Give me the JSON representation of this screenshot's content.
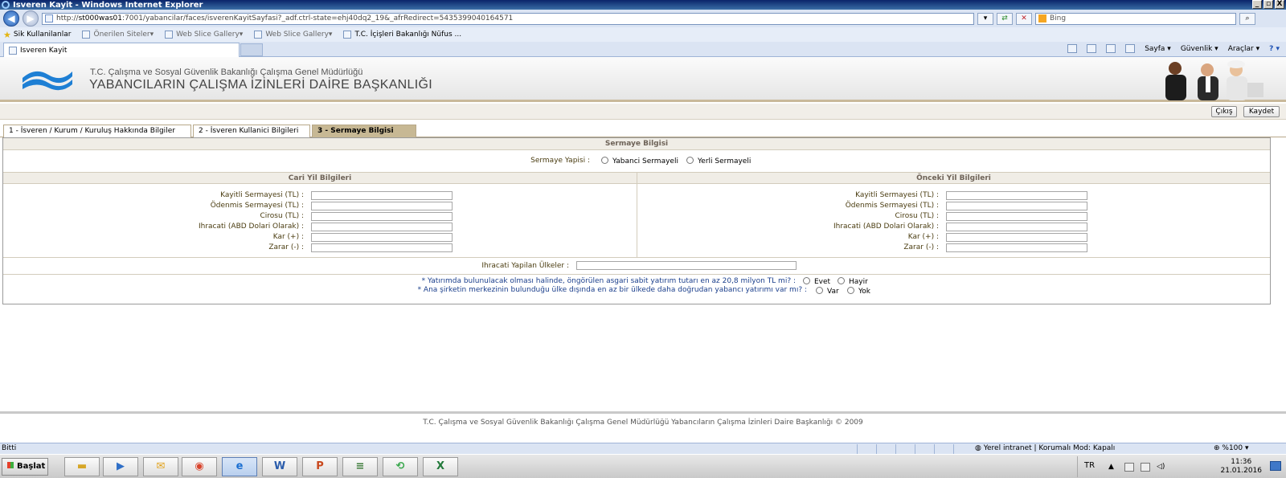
{
  "window": {
    "title": "Isveren Kayit - Windows Internet Explorer",
    "buttons": [
      "_",
      "▫",
      "X"
    ]
  },
  "address": {
    "prefix": "http://",
    "host": "st000was01",
    "path": ":7001/yabancilar/faces/isverenKayitSayfasi?_adf.ctrl-state=ehj40dq2_19&_afrRedirect=5435399040164571",
    "search_placeholder": "Bing"
  },
  "favorites": {
    "label": "Sik Kullanilanlar",
    "items": [
      "Önerilen Siteler",
      "Web Slice Gallery",
      "Web Slice Gallery",
      "T.C. İçişleri Bakanlığı Nüfus ..."
    ]
  },
  "tab": {
    "title": "Isveren Kayit"
  },
  "commandbar": {
    "sayfa": "Sayfa",
    "guvenlik": "Güvenlik",
    "araclar": "Araçlar"
  },
  "banner": {
    "ministry": "T.C. Çalışma ve Sosyal Güvenlik Bakanlığı Çalışma Genel Müdürlüğü",
    "department": "YABANCILARIN ÇALIŞMA İZİNLERİ DAİRE BAŞKANLIĞI"
  },
  "actions": {
    "exit": "Çıkış",
    "save": "Kaydet"
  },
  "form_tabs": [
    "1 - İsveren / Kurum / Kuruluş Hakkında Bilgiler",
    "2 - İsveren Kullanici Bilgileri",
    "3 - Sermaye Bilgisi"
  ],
  "form": {
    "section_title": "Sermaye Bilgisi",
    "capital_structure_label": "Sermaye Yapisi :",
    "foreign_capital": "Yabanci Sermayeli",
    "local_capital": "Yerli Sermayeli",
    "current_year_title": "Cari Yil Bilgileri",
    "previous_year_title": "Önceki Yil Bilgileri",
    "fields": [
      "Kayitli Sermayesi (TL) :",
      "Ödenmis Sermayesi (TL) :",
      "Cirosu (TL) :",
      "Ihracati (ABD Dolari Olarak) :",
      "Kar (+) :",
      "Zarar (-) :"
    ],
    "export_countries_label": "Ihracati Yapilan Ülkeler :",
    "question1": "* Yatırımda bulunulacak olması halinde, öngörülen asgari sabit yatırım tutarı en az 20,8 milyon TL mi? :",
    "q1_yes": "Evet",
    "q1_no": "Hayir",
    "question2": "* Ana şirketin merkezinin bulunduğu ülke dışında en az bir ülkede daha doğrudan yabancı yatırımı var mı? :",
    "q2_yes": "Var",
    "q2_no": "Yok"
  },
  "footer": "T.C. Çalışma ve Sosyal Güvenlik Bakanlığı Çalışma Genel Müdürlüğü Yabancıların Çalışma İzinleri Daire Başkanlığı © 2009",
  "status": {
    "left": "Bitti",
    "zone": "Yerel intranet | Korumalı Mod: Kapalı",
    "zoom": "%100"
  },
  "taskbar": {
    "start": "Başlat",
    "lang": "TR",
    "time": "11:36",
    "date": "21.01.2016"
  }
}
